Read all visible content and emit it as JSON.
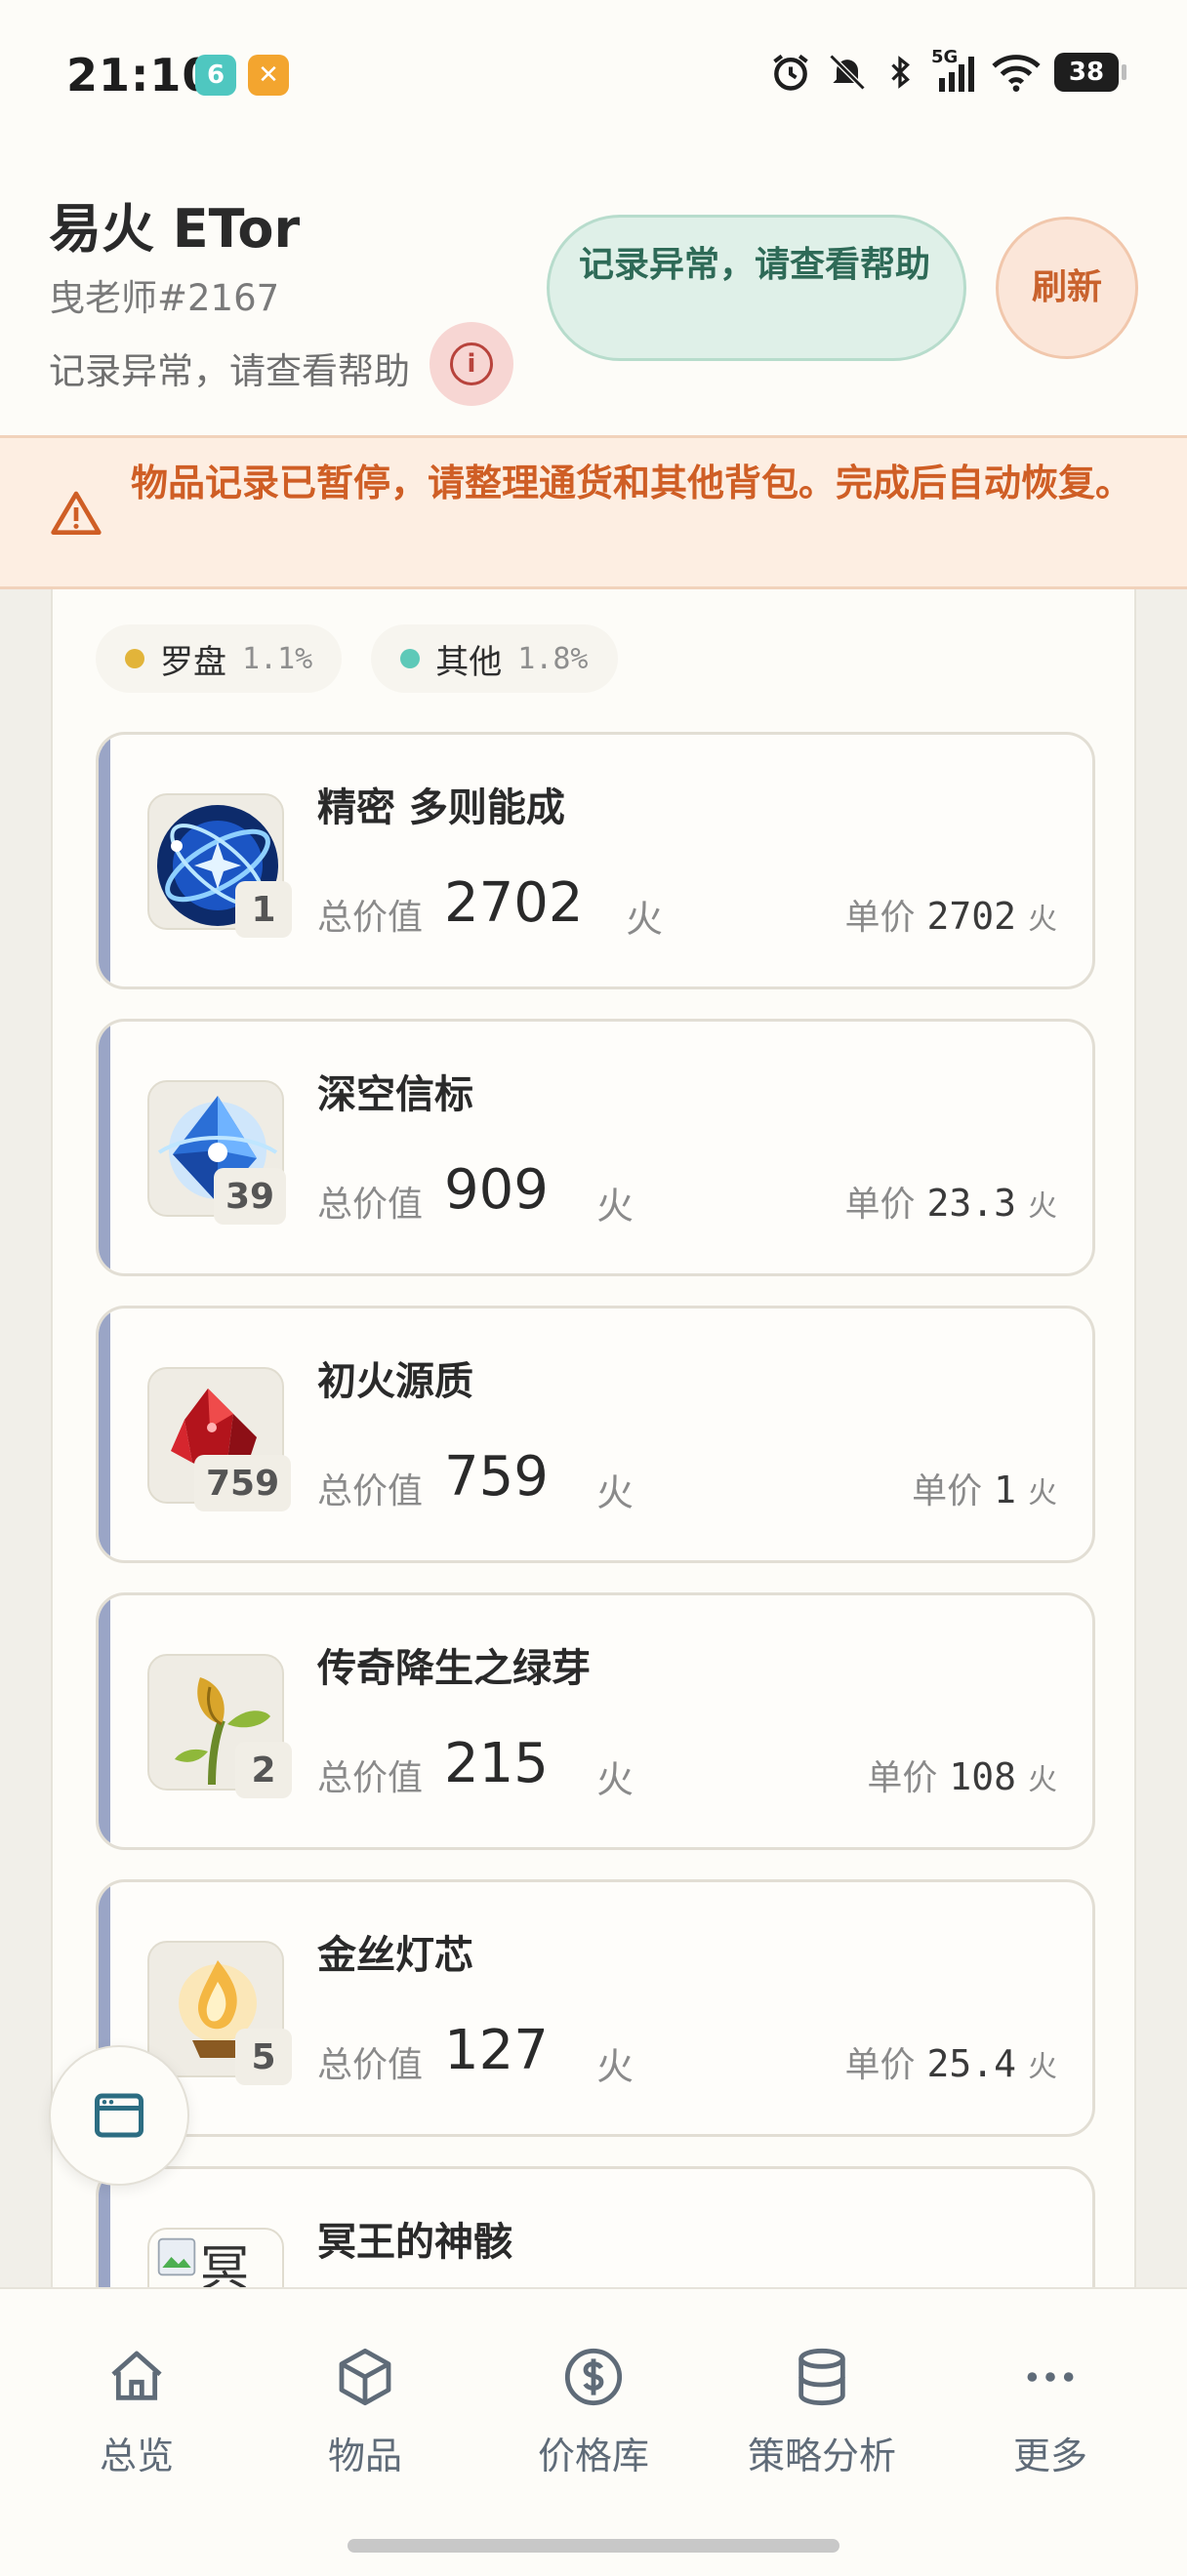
{
  "status_bar": {
    "time": "21:10",
    "signal_label": "5G",
    "battery": "38"
  },
  "header": {
    "user_name": "易火 ETor",
    "user_tag": "曳老师#2167",
    "status_text": "记录异常，请查看帮助",
    "status_pill": "记录异常，请查看帮助",
    "refresh_label": "刷新"
  },
  "alert": {
    "text": "物品记录已暂停，请整理通货和其他背包。完成后自动恢复。"
  },
  "legend": [
    {
      "label": "罗盘",
      "pct": "1.1%",
      "color": "#e2b43a"
    },
    {
      "label": "其他",
      "pct": "1.8%",
      "color": "#5ec9b8"
    }
  ],
  "items": [
    {
      "name": "精密 多则能成",
      "qty": "1",
      "total_label": "总价值",
      "total": "2702",
      "unit": "火",
      "unit_label": "单价",
      "unit_price": "2702",
      "unit_suffix": "火",
      "thumb": "compass-orb"
    },
    {
      "name": "深空信标",
      "qty": "39",
      "total_label": "总价值",
      "total": "909",
      "unit": "火",
      "unit_label": "单价",
      "unit_price": "23.3",
      "unit_suffix": "火",
      "thumb": "blue-crystal"
    },
    {
      "name": "初火源质",
      "qty": "759",
      "total_label": "总价值",
      "total": "759",
      "unit": "火",
      "unit_label": "单价",
      "unit_price": "1",
      "unit_suffix": "火",
      "thumb": "red-crystal"
    },
    {
      "name": "传奇降生之绿芽",
      "qty": "2",
      "total_label": "总价值",
      "total": "215",
      "unit": "火",
      "unit_label": "单价",
      "unit_price": "108",
      "unit_suffix": "火",
      "thumb": "golden-sprout"
    },
    {
      "name": "金丝灯芯",
      "qty": "5",
      "total_label": "总价值",
      "total": "127",
      "unit": "火",
      "unit_label": "单价",
      "unit_price": "25.4",
      "unit_suffix": "火",
      "thumb": "golden-flame"
    },
    {
      "name": "冥王的神骸",
      "qty": "",
      "total_label": "",
      "total": "",
      "unit": "",
      "unit_label": "",
      "unit_price": "",
      "unit_suffix": "",
      "thumb": "broken-image",
      "thumb_alt": "冥"
    }
  ],
  "bottom_nav": [
    {
      "label": "总览",
      "icon": "home-icon"
    },
    {
      "label": "物品",
      "icon": "box-icon"
    },
    {
      "label": "价格库",
      "icon": "dollar-icon"
    },
    {
      "label": "策略分析",
      "icon": "database-icon"
    },
    {
      "label": "更多",
      "icon": "more-icon"
    }
  ],
  "colors": {
    "accent_green": "#2e6a57",
    "accent_orange": "#c9622d",
    "alert_text": "#cf5e25",
    "item_bar": "#9aa5c6"
  }
}
